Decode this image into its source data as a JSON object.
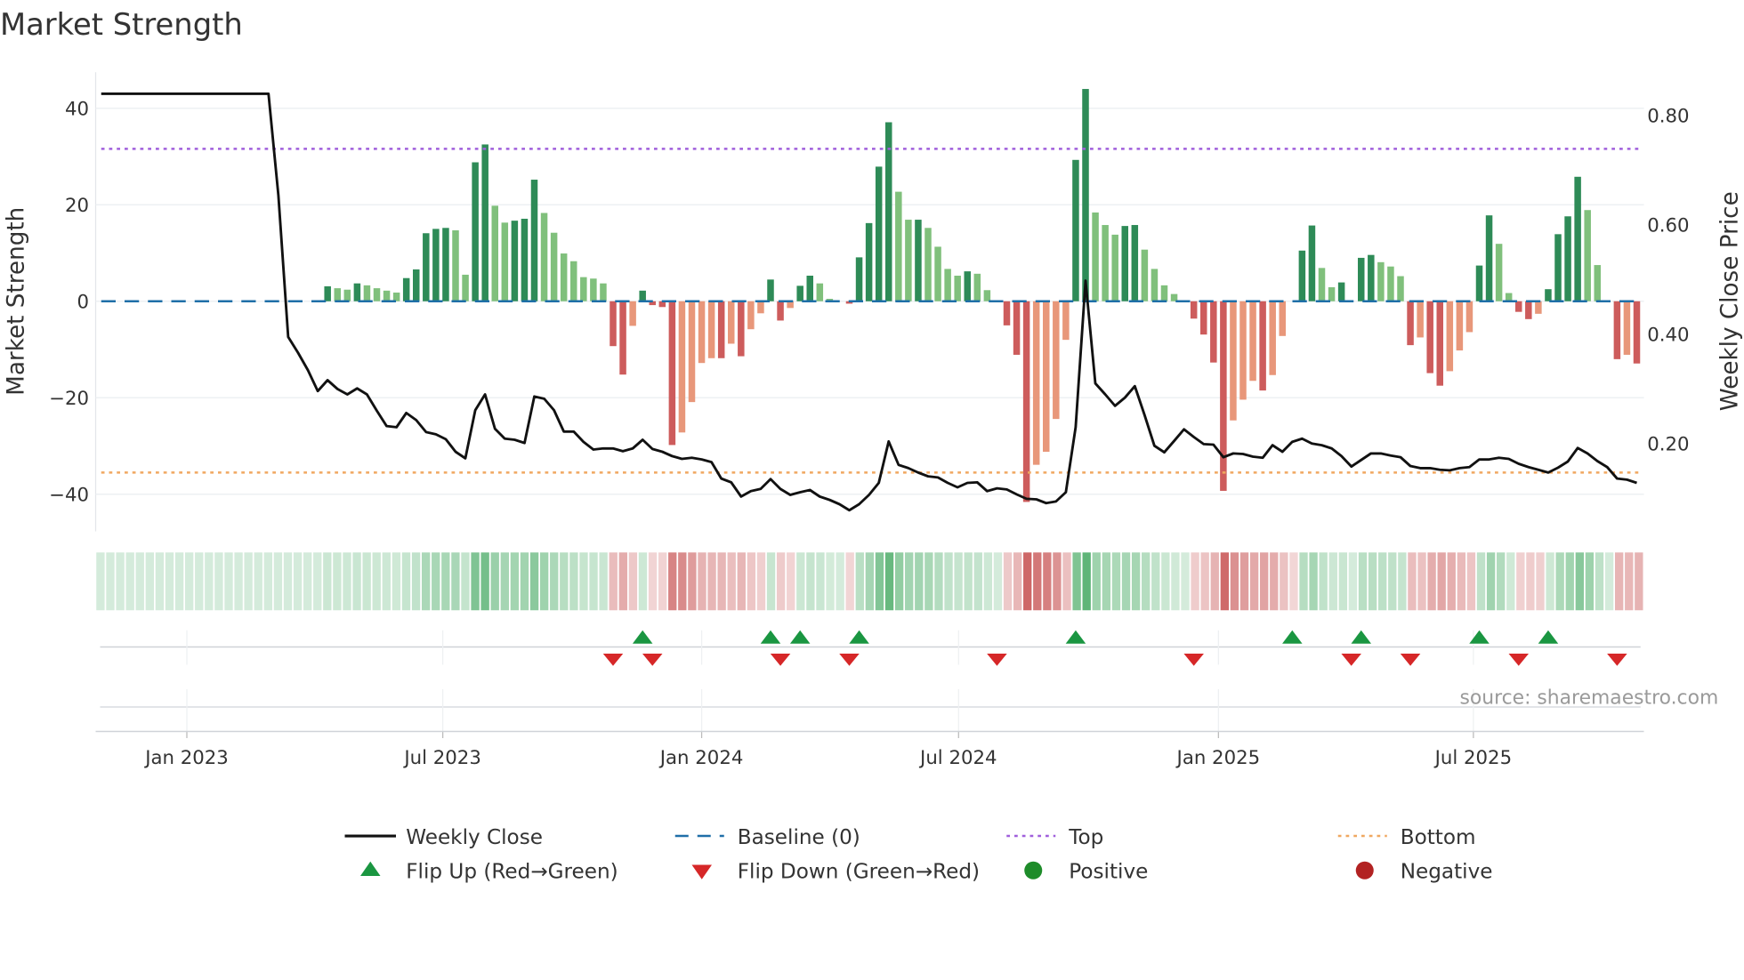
{
  "chart_data": {
    "type": "bar",
    "title": "Market Strength",
    "ylabel": "Market Strength",
    "y2label": "Weekly Close Price",
    "ylim": [
      -48,
      48
    ],
    "y2lim": [
      0.06,
      0.88
    ],
    "yticks": [
      {
        "value": 40,
        "label": "40"
      },
      {
        "value": 20,
        "label": "20"
      },
      {
        "value": 0,
        "label": "0"
      },
      {
        "value": -20,
        "label": "−20"
      },
      {
        "value": -40,
        "label": "−40"
      }
    ],
    "y2ticks": [
      {
        "value": 0.8,
        "label": "0.80"
      },
      {
        "value": 0.6,
        "label": "0.60"
      },
      {
        "value": 0.4,
        "label": "0.40"
      },
      {
        "value": 0.2,
        "label": "0.20"
      }
    ],
    "x_unit": "week index",
    "xticks": [
      {
        "week": 8.7,
        "label": "Jan 2023"
      },
      {
        "week": 34.7,
        "label": "Jul 2023"
      },
      {
        "week": 61.0,
        "label": "Jan 2024"
      },
      {
        "week": 87.1,
        "label": "Jul 2024"
      },
      {
        "week": 113.5,
        "label": "Jan 2025"
      },
      {
        "week": 139.4,
        "label": "Jul 2025"
      }
    ],
    "top_level": 31.6,
    "bottom_level": -35.5,
    "baseline": 0,
    "strength": [
      0,
      0,
      0,
      0,
      0,
      0,
      0,
      0,
      0,
      0,
      0,
      0,
      0,
      0,
      0,
      0,
      0,
      0,
      0,
      0,
      0,
      0,
      0,
      3.1,
      2.7,
      2.4,
      3.7,
      3.3,
      2.7,
      2.2,
      1.8,
      4.8,
      6.6,
      14.1,
      15.0,
      15.2,
      14.7,
      5.5,
      28.8,
      32.5,
      19.8,
      16.3,
      16.7,
      17.1,
      25.2,
      18.3,
      14.2,
      9.9,
      8.3,
      5.0,
      4.7,
      3.7,
      -9.3,
      -15.2,
      -5.1,
      2.2,
      -0.8,
      -1.2,
      -29.8,
      -27.2,
      -20.9,
      -12.8,
      -11.8,
      -11.8,
      -8.8,
      -11.4,
      -5.8,
      -2.5,
      4.5,
      -4.0,
      -1.4,
      3.2,
      5.3,
      3.7,
      0.5,
      0,
      -0.5,
      9.1,
      16.2,
      27.9,
      37.1,
      22.7,
      16.9,
      16.9,
      15.2,
      11.3,
      6.7,
      5.3,
      6.2,
      5.7,
      2.3,
      0,
      -5.0,
      -11.1,
      -41.6,
      -33.9,
      -31.2,
      -24.4,
      -8.0,
      29.3,
      44.0,
      18.4,
      15.8,
      13.8,
      15.6,
      15.8,
      10.7,
      6.7,
      3.3,
      1.5,
      0,
      -3.6,
      -6.9,
      -12.7,
      -39.3,
      -24.7,
      -20.4,
      -16.5,
      -18.5,
      -15.3,
      -7.2,
      0,
      10.5,
      15.7,
      6.9,
      2.9,
      3.9,
      0,
      9.0,
      9.6,
      8.1,
      7.2,
      5.2,
      -9.1,
      -7.5,
      -14.9,
      -17.5,
      -14.5,
      -10.2,
      -6.4,
      7.4,
      17.8,
      11.9,
      1.7,
      -2.2,
      -3.7,
      -2.6,
      2.5,
      13.9,
      17.6,
      25.8,
      18.9,
      7.5,
      0,
      -12.0,
      -11.1,
      -12.9
    ],
    "weekly_close": [
      0.84,
      0.84,
      0.84,
      0.84,
      0.84,
      0.84,
      0.84,
      0.84,
      0.84,
      0.84,
      0.84,
      0.84,
      0.84,
      0.84,
      0.84,
      0.84,
      0.84,
      0.84,
      0.654,
      0.395,
      0.366,
      0.334,
      0.296,
      0.316,
      0.3,
      0.29,
      0.301,
      0.29,
      0.26,
      0.232,
      0.23,
      0.256,
      0.243,
      0.221,
      0.217,
      0.208,
      0.185,
      0.173,
      0.261,
      0.29,
      0.227,
      0.209,
      0.207,
      0.201,
      0.286,
      0.282,
      0.261,
      0.222,
      0.222,
      0.203,
      0.189,
      0.191,
      0.191,
      0.186,
      0.191,
      0.207,
      0.19,
      0.185,
      0.177,
      0.172,
      0.174,
      0.171,
      0.166,
      0.136,
      0.129,
      0.103,
      0.113,
      0.117,
      0.135,
      0.117,
      0.106,
      0.111,
      0.115,
      0.103,
      0.097,
      0.089,
      0.078,
      0.089,
      0.106,
      0.128,
      0.204,
      0.161,
      0.155,
      0.147,
      0.14,
      0.138,
      0.128,
      0.12,
      0.128,
      0.129,
      0.113,
      0.118,
      0.116,
      0.107,
      0.099,
      0.098,
      0.091,
      0.094,
      0.111,
      0.23,
      0.498,
      0.31,
      0.29,
      0.269,
      0.284,
      0.305,
      0.252,
      0.196,
      0.184,
      0.205,
      0.226,
      0.212,
      0.199,
      0.198,
      0.175,
      0.182,
      0.181,
      0.176,
      0.174,
      0.197,
      0.185,
      0.203,
      0.209,
      0.2,
      0.197,
      0.191,
      0.177,
      0.158,
      0.17,
      0.182,
      0.182,
      0.178,
      0.175,
      0.159,
      0.155,
      0.155,
      0.152,
      0.151,
      0.155,
      0.157,
      0.171,
      0.171,
      0.174,
      0.172,
      0.163,
      0.157,
      0.152,
      0.147,
      0.156,
      0.167,
      0.192,
      0.182,
      0.168,
      0.157,
      0.136,
      0.134,
      0.128
    ],
    "flip_up_weeks": [
      55,
      68,
      71,
      77,
      99,
      121,
      128,
      140,
      147
    ],
    "flip_down_weeks": [
      52,
      56,
      69,
      76,
      91,
      111,
      127,
      133,
      144,
      154
    ],
    "legend": {
      "placement": "bottom",
      "items": [
        {
          "label": "Weekly Close"
        },
        {
          "label": "Baseline (0)"
        },
        {
          "label": "Top"
        },
        {
          "label": "Bottom"
        },
        {
          "label": "Flip Up (Red→Green)"
        },
        {
          "label": "Flip Down (Green→Red)"
        },
        {
          "label": "Positive"
        },
        {
          "label": "Negative"
        }
      ]
    },
    "source": "source: sharemaestro.com",
    "colors": {
      "pos_strong": "#2e8b57",
      "pos_weak": "#80c07c",
      "neg_strong": "#cd5c5c",
      "neg_weak": "#e8977a",
      "line": "#111111",
      "baseline": "#1f6fa8",
      "top": "#a05fdc",
      "bottom": "#f0a860",
      "flip_up": "#1a9641",
      "flip_down": "#d62728",
      "positive": "#1e8c2a",
      "negative": "#b22222"
    }
  }
}
